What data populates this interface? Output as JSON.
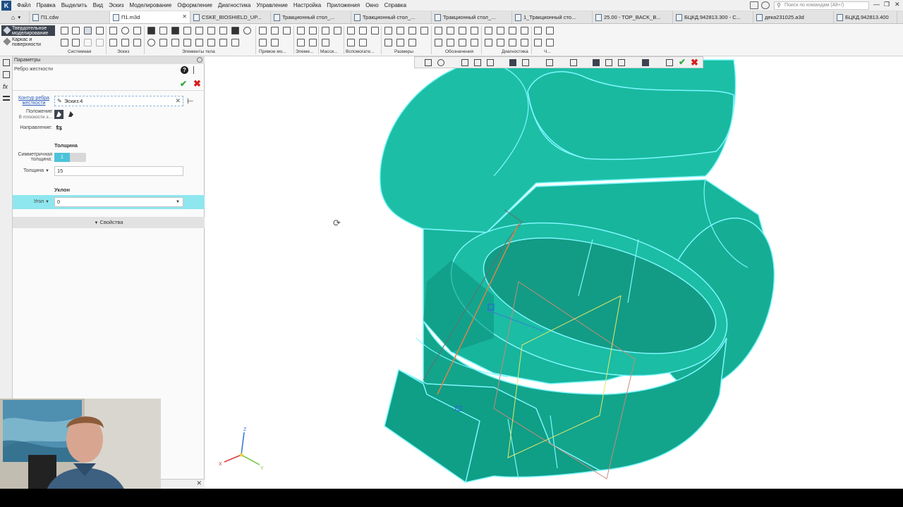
{
  "menu": [
    "Файл",
    "Правка",
    "Выделить",
    "Вид",
    "Эскиз",
    "Моделирование",
    "Оформление",
    "Диагностика",
    "Управление",
    "Настройка",
    "Приложения",
    "Окно",
    "Справка"
  ],
  "search": {
    "placeholder": "Поиск по командам (Alt+/)"
  },
  "tabs": [
    {
      "label": "П1.cdw",
      "active": false
    },
    {
      "label": "П1.m3d",
      "active": true
    },
    {
      "label": "CSKE_BIOSHIELD_UP...",
      "active": false
    },
    {
      "label": "Тракционный стол_...",
      "active": false
    },
    {
      "label": "Тракционный стол_...",
      "active": false
    },
    {
      "label": "Тракционный стол_...",
      "active": false
    },
    {
      "label": "1_Тракционный сто...",
      "active": false
    },
    {
      "label": "25.00 - TOP_BACK_B...",
      "active": false
    },
    {
      "label": "БЦКД.942813.300 - С...",
      "active": false
    },
    {
      "label": "дека231025.a3d",
      "active": false
    },
    {
      "label": "БЦКД.942813.400",
      "active": false
    }
  ],
  "ribbon": {
    "modes": [
      {
        "label": "Твердотельное моделирование",
        "active": true
      },
      {
        "label": "Каркас и поверхности",
        "active": false
      }
    ],
    "groups": [
      "Системная",
      "Эскиз",
      "Элементы тела",
      "Прямое мо...",
      "Элеме...",
      "Масси...",
      "Вспомогате...",
      "Размеры",
      "Обозначения",
      "Диагностика",
      "Ч..."
    ]
  },
  "panel": {
    "header": "Параметры",
    "command": "Ребро жесткости",
    "contour_label": "Контур ребра жесткости",
    "sketch_value": "Эскиз:4",
    "position_label": "Положение",
    "position_sub": "В плоскости э...",
    "direction_label": "Направление:",
    "thickness_section": "Толщина",
    "symmetric_label": "Симметричная толщина:",
    "symmetric_value": "1",
    "thickness_label": "Толщина",
    "thickness_value": "15",
    "slope_section": "Уклон",
    "angle_label": "Угол",
    "angle_value": "0",
    "properties_label": "Свойства"
  },
  "axes": {
    "x": "X",
    "y": "Y",
    "z": "Z"
  },
  "colors": {
    "model_fill": "#1cbfa6",
    "model_dark": "#0f9d86",
    "model_edge": "#7ff6ff",
    "highlight": "#8ee6ee",
    "accent_dark": "#3d4450",
    "ok": "#2eaa3e",
    "cancel": "#d62020"
  }
}
